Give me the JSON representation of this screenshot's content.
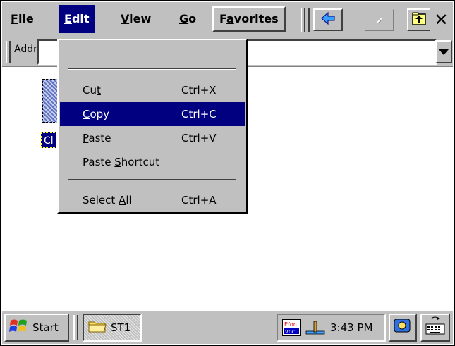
{
  "menubar": {
    "items": [
      {
        "label": "File",
        "underline": "F",
        "rest": "ile"
      },
      {
        "label": "Edit",
        "underline": "E",
        "rest": "dit"
      },
      {
        "label": "View",
        "underline": "V",
        "rest": "iew"
      },
      {
        "label": "Go",
        "underline": "G",
        "rest": "o"
      },
      {
        "label": "Favorites",
        "pre": "F",
        "underline": "a",
        "rest": "vorites"
      }
    ],
    "toolbar_icons": [
      "back-icon",
      "forward-icon",
      "up-folder-icon",
      "close-icon"
    ]
  },
  "address": {
    "label": "Addr",
    "value": ""
  },
  "content": {
    "file_label": "Cl"
  },
  "edit_menu": {
    "items": [
      {
        "pre": "Cu",
        "ul": "t",
        "post": "",
        "accel": "Ctrl+X"
      },
      {
        "pre": "",
        "ul": "C",
        "post": "opy",
        "accel": "Ctrl+C"
      },
      {
        "pre": "",
        "ul": "P",
        "post": "aste",
        "accel": "Ctrl+V"
      },
      {
        "pre": "Paste ",
        "ul": "S",
        "post": "hortcut",
        "accel": ""
      },
      {
        "pre": "Select ",
        "ul": "A",
        "post": "ll",
        "accel": "Ctrl+A"
      }
    ],
    "highlighted_index": 1
  },
  "taskbar": {
    "start_label": "Start",
    "task_label": "ST1",
    "tray_badge": "Efon vnc",
    "clock": "3:43 PM"
  },
  "colors": {
    "highlight": "#000080",
    "chrome": "#c0c0c0"
  }
}
